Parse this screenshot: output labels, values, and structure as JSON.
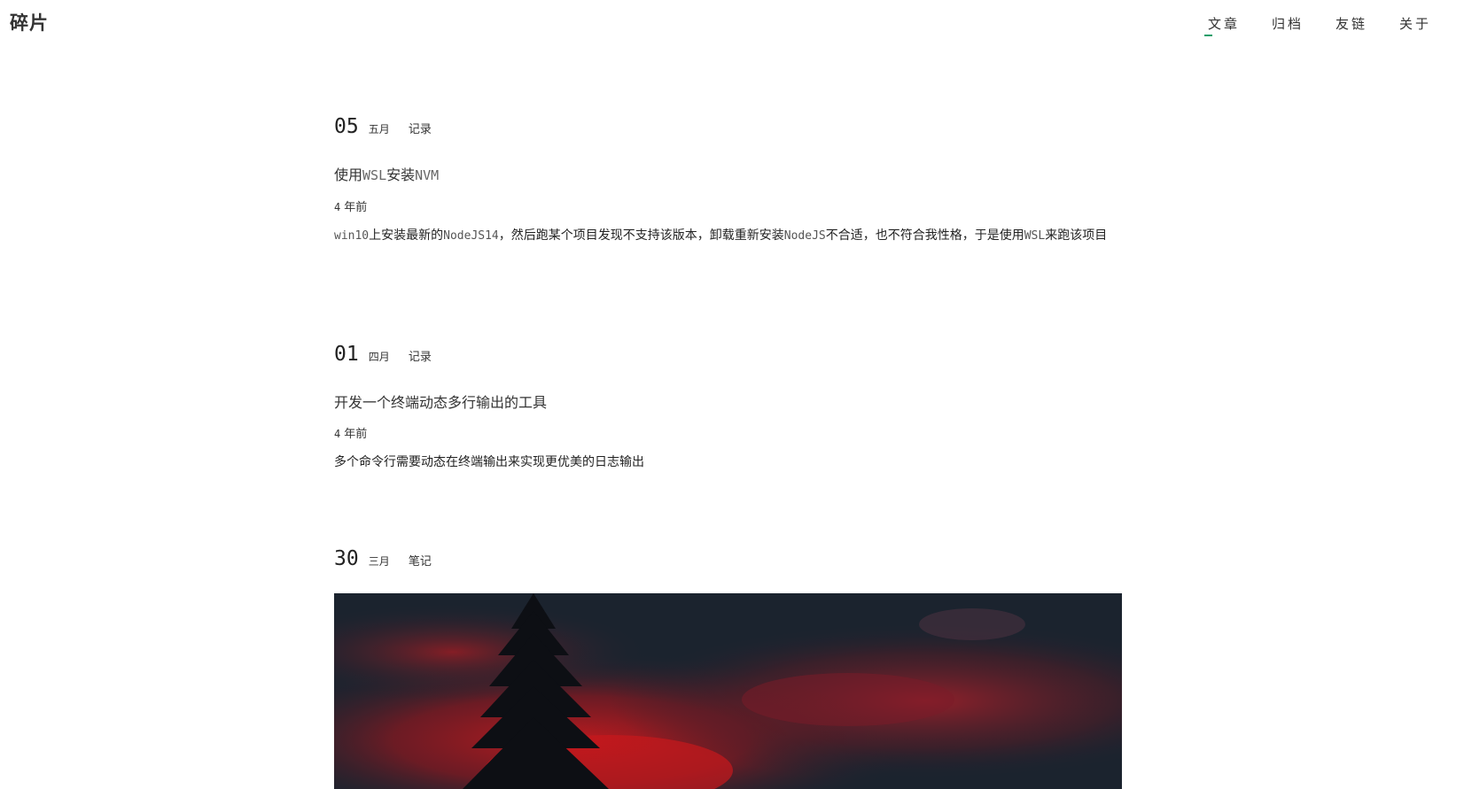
{
  "site": {
    "title": "碎片"
  },
  "nav": {
    "items": [
      {
        "label": "文章",
        "active": true
      },
      {
        "label": "归档",
        "active": false
      },
      {
        "label": "友链",
        "active": false
      },
      {
        "label": "关于",
        "active": false
      }
    ],
    "accent_color": "#1a9e6a"
  },
  "posts": [
    {
      "day": "05",
      "month": "五月",
      "category": "记录",
      "title_parts": [
        "使用",
        "WSL",
        "安装",
        "NVM"
      ],
      "ago_num": "4",
      "ago_unit": "年前",
      "excerpt_parts": [
        "win10",
        "上安装最新的",
        "NodeJS14",
        "，然后跑某个项目发现不支持该版本，卸载重新安装",
        "NodeJS",
        "不合适，也不符合我性格，于是使用",
        "WSL",
        "来跑该项目"
      ]
    },
    {
      "day": "01",
      "month": "四月",
      "category": "记录",
      "title": "开发一个终端动态多行输出的工具",
      "ago_num": "4",
      "ago_unit": "年前",
      "excerpt": "多个命令行需要动态在终端输出来实现更优美的日志输出"
    },
    {
      "day": "30",
      "month": "三月",
      "category": "笔记",
      "cover_icon": "red-sky-tree-photo"
    }
  ]
}
